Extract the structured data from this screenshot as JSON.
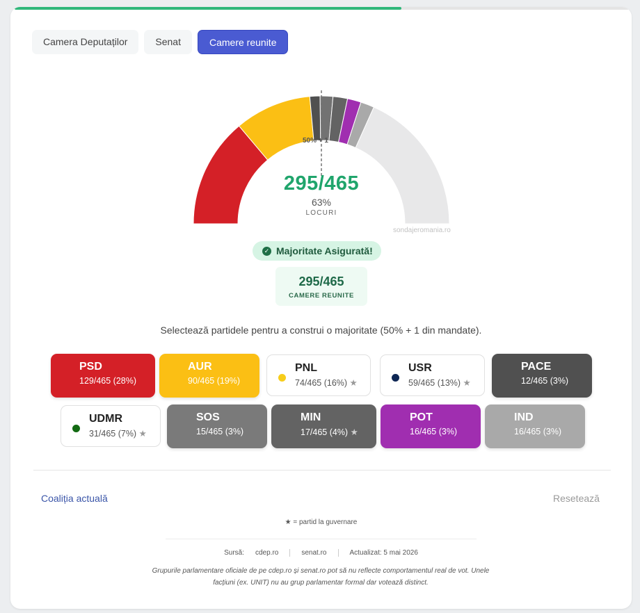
{
  "progress": {
    "fraction": 0.63
  },
  "tabs": [
    {
      "label": "Camera Deputaților",
      "active": false
    },
    {
      "label": "Senat",
      "active": false
    },
    {
      "label": "Camere reunite",
      "active": true
    }
  ],
  "gauge": {
    "majority_marker": "50% + 1",
    "main_value": "295/465",
    "percent": "63%",
    "unit_label": "LOCURI",
    "watermark": "sondajeromania.ro",
    "total_seats": 465,
    "segments": [
      {
        "party": "PSD",
        "seats": 129,
        "color": "#d42027"
      },
      {
        "party": "AUR",
        "seats": 90,
        "color": "#fbbf14"
      },
      {
        "party": "PACE",
        "seats": 12,
        "color": "#505050"
      },
      {
        "party": "SOS",
        "seats": 15,
        "color": "#727272"
      },
      {
        "party": "MIN",
        "seats": 17,
        "color": "#636363"
      },
      {
        "party": "POT",
        "seats": 16,
        "color": "#a02eb0"
      },
      {
        "party": "IND",
        "seats": 16,
        "color": "#a9a9a9"
      },
      {
        "party": "rest",
        "seats": 170,
        "color": "#e8e8e9"
      }
    ]
  },
  "status": {
    "badge": "Majoritate Asigurată!",
    "combined_value": "295/465",
    "combined_label": "CAMERE REUNITE"
  },
  "instruction": "Selectează partidele pentru a construi o majoritate (50% + 1 din mandate).",
  "parties": [
    {
      "name": "PSD",
      "seats": "129/465 (28%)",
      "selected": true,
      "color": "#d42027",
      "governing": false
    },
    {
      "name": "AUR",
      "seats": "90/465 (19%)",
      "selected": true,
      "color": "#fbbf14",
      "governing": false
    },
    {
      "name": "PNL",
      "seats": "74/465 (16%)",
      "selected": false,
      "color": "#f7cd1b",
      "governing": true,
      "star": "★"
    },
    {
      "name": "USR",
      "seats": "59/465 (13%)",
      "selected": false,
      "color": "#0e2754",
      "governing": true,
      "star": "★"
    },
    {
      "name": "PACE",
      "seats": "12/465 (3%)",
      "selected": true,
      "color": "#505050",
      "governing": false
    },
    {
      "name": "UDMR",
      "seats": "31/465 (7%)",
      "selected": false,
      "color": "#126a12",
      "governing": true,
      "star": "★"
    },
    {
      "name": "SOS",
      "seats": "15/465 (3%)",
      "selected": true,
      "color": "#7a7a7a",
      "governing": false
    },
    {
      "name": "MIN",
      "seats": "17/465 (4%)",
      "selected": true,
      "color": "#636363",
      "governing": true,
      "star": "★"
    },
    {
      "name": "POT",
      "seats": "16/465 (3%)",
      "selected": true,
      "color": "#a02eb0",
      "governing": false
    },
    {
      "name": "IND",
      "seats": "16/465 (3%)",
      "selected": true,
      "color": "#a9a9a9",
      "governing": false
    }
  ],
  "footer": {
    "coalition_link": "Coaliția actuală",
    "reset_link": "Resetează",
    "legend_note": "★ = partid la guvernare",
    "source_label": "Sursă:",
    "source_1": "cdep.ro",
    "source_2": "senat.ro",
    "updated": "Actualizat: 5 mai 2026",
    "disclaimer": "Grupurile parlamentare oficiale de pe cdep.ro și senat.ro pot să nu reflecte comportamentul real de vot. Unele facțiuni (ex. UNIT) nu au grup parlamentar formal dar votează distinct."
  }
}
